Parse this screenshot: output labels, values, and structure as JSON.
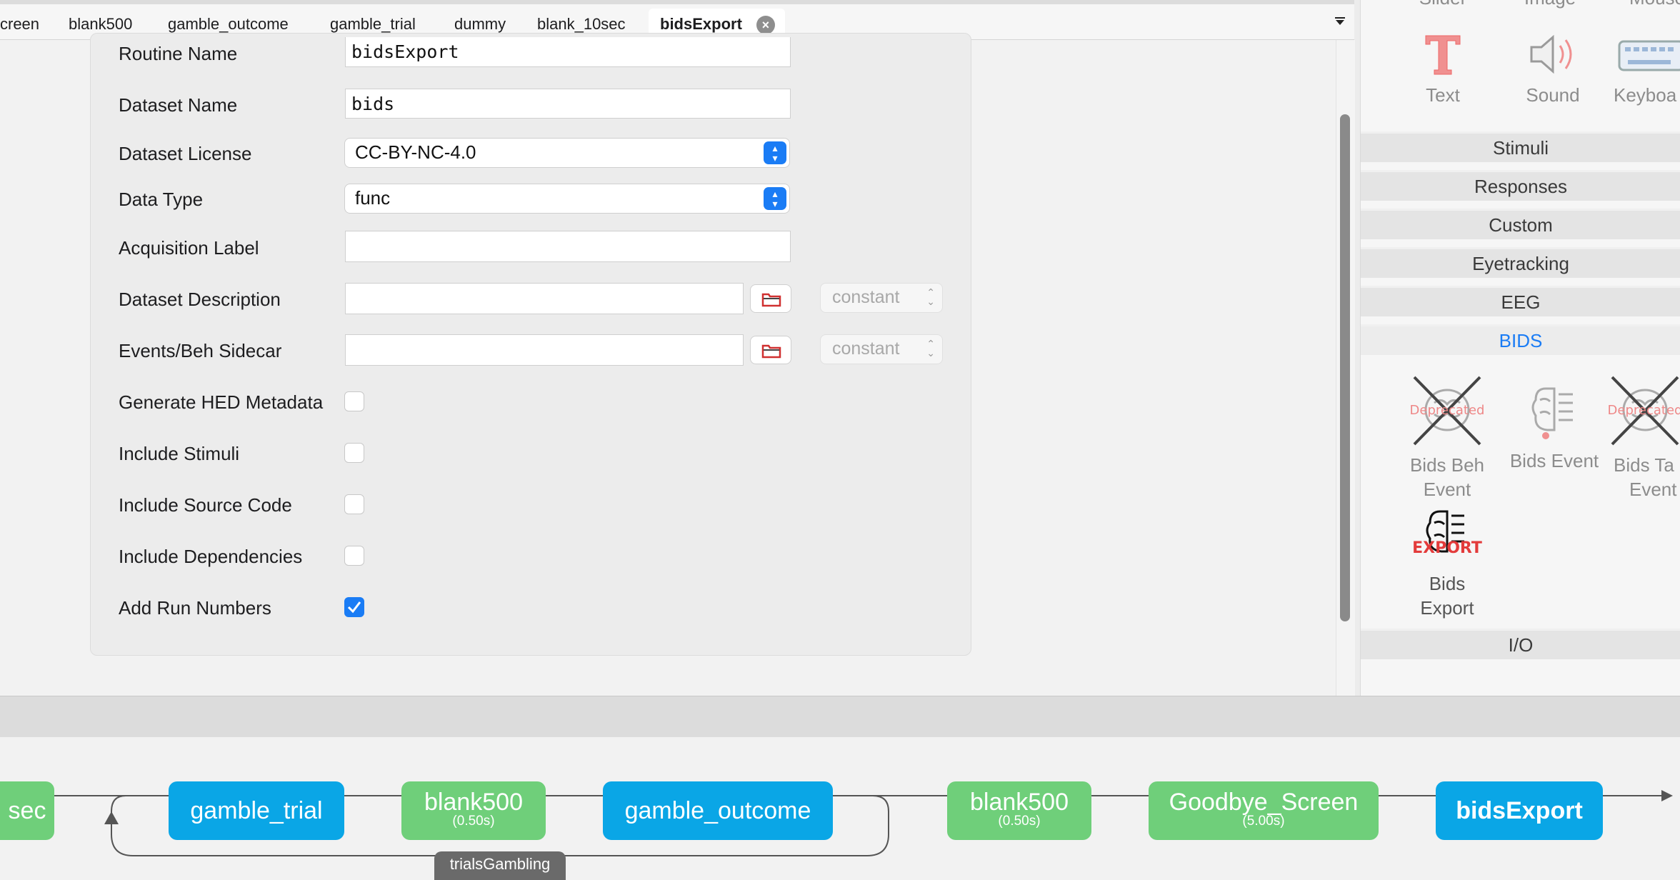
{
  "tabs": [
    {
      "label": "creen",
      "active": false
    },
    {
      "label": "blank500",
      "active": false
    },
    {
      "label": "gamble_outcome",
      "active": false
    },
    {
      "label": "gamble_trial",
      "active": false
    },
    {
      "label": "dummy",
      "active": false
    },
    {
      "label": "blank_10sec",
      "active": false
    },
    {
      "label": "bidsExport",
      "active": true
    }
  ],
  "tab_overflow_icon": "chevron-down",
  "form": {
    "routine_name": {
      "label": "Routine Name",
      "value": "bidsExport"
    },
    "dataset_name": {
      "label": "Dataset Name",
      "value": "bids"
    },
    "dataset_license": {
      "label": "Dataset License",
      "value": "CC-BY-NC-4.0"
    },
    "data_type": {
      "label": "Data Type",
      "value": "func"
    },
    "acquisition_label": {
      "label": "Acquisition Label",
      "value": ""
    },
    "dataset_description": {
      "label": "Dataset Description",
      "value": "",
      "valtype": "constant"
    },
    "events_sidecar": {
      "label": "Events/Beh Sidecar",
      "value": "",
      "valtype": "constant"
    },
    "generate_hed": {
      "label": "Generate HED Metadata",
      "checked": false
    },
    "include_stimuli": {
      "label": "Include Stimuli",
      "checked": false
    },
    "include_source_code": {
      "label": "Include Source Code",
      "checked": false
    },
    "include_dependencies": {
      "label": "Include Dependencies",
      "checked": false
    },
    "add_run_numbers": {
      "label": "Add Run Numbers",
      "checked": true
    }
  },
  "components": {
    "partial_top_labels": [
      "Slider",
      "Image",
      "Mouse"
    ],
    "stimuli_items": [
      {
        "label": "Text",
        "icon": "text-icon"
      },
      {
        "label": "Sound",
        "icon": "speaker-icon"
      },
      {
        "label": "Keyboa",
        "icon": "keyboard-icon"
      }
    ],
    "categories": [
      "Stimuli",
      "Responses",
      "Custom",
      "Eyetracking",
      "EEG",
      "BIDS"
    ],
    "active_category": "BIDS",
    "bids_items": [
      {
        "line1": "Bids Beh",
        "line2": "Event",
        "icon": "deprecated-brain-icon",
        "overlay": "Deprecated"
      },
      {
        "line1": "Bids Event",
        "line2": "",
        "icon": "brain-checklist-icon"
      },
      {
        "line1": "Bids Ta",
        "line2": "Event",
        "icon": "deprecated-brain-icon",
        "overlay": "Deprecated"
      },
      {
        "line1": "Bids",
        "line2": "Export",
        "icon": "brain-export-icon",
        "overlay": "EXPORT"
      }
    ],
    "io_category": "I/O"
  },
  "flow": {
    "routines": [
      {
        "name": "sec",
        "duration": "",
        "color": "green"
      },
      {
        "name": "gamble_trial",
        "duration": "",
        "color": "blue"
      },
      {
        "name": "blank500",
        "duration": "(0.50s)",
        "color": "green"
      },
      {
        "name": "gamble_outcome",
        "duration": "",
        "color": "blue"
      },
      {
        "name": "blank500",
        "duration": "(0.50s)",
        "color": "green"
      },
      {
        "name": "Goodbye_Screen",
        "duration": "(5.00s)",
        "color": "green"
      },
      {
        "name": "bidsExport",
        "duration": "",
        "color": "blue"
      }
    ],
    "loop_label": "trialsGambling"
  },
  "colors": {
    "accent": "#1a7cf5",
    "routine_green": "#6fcf7a",
    "routine_blue": "#0aa6e6",
    "deprecated_red": "#e33b3b"
  }
}
